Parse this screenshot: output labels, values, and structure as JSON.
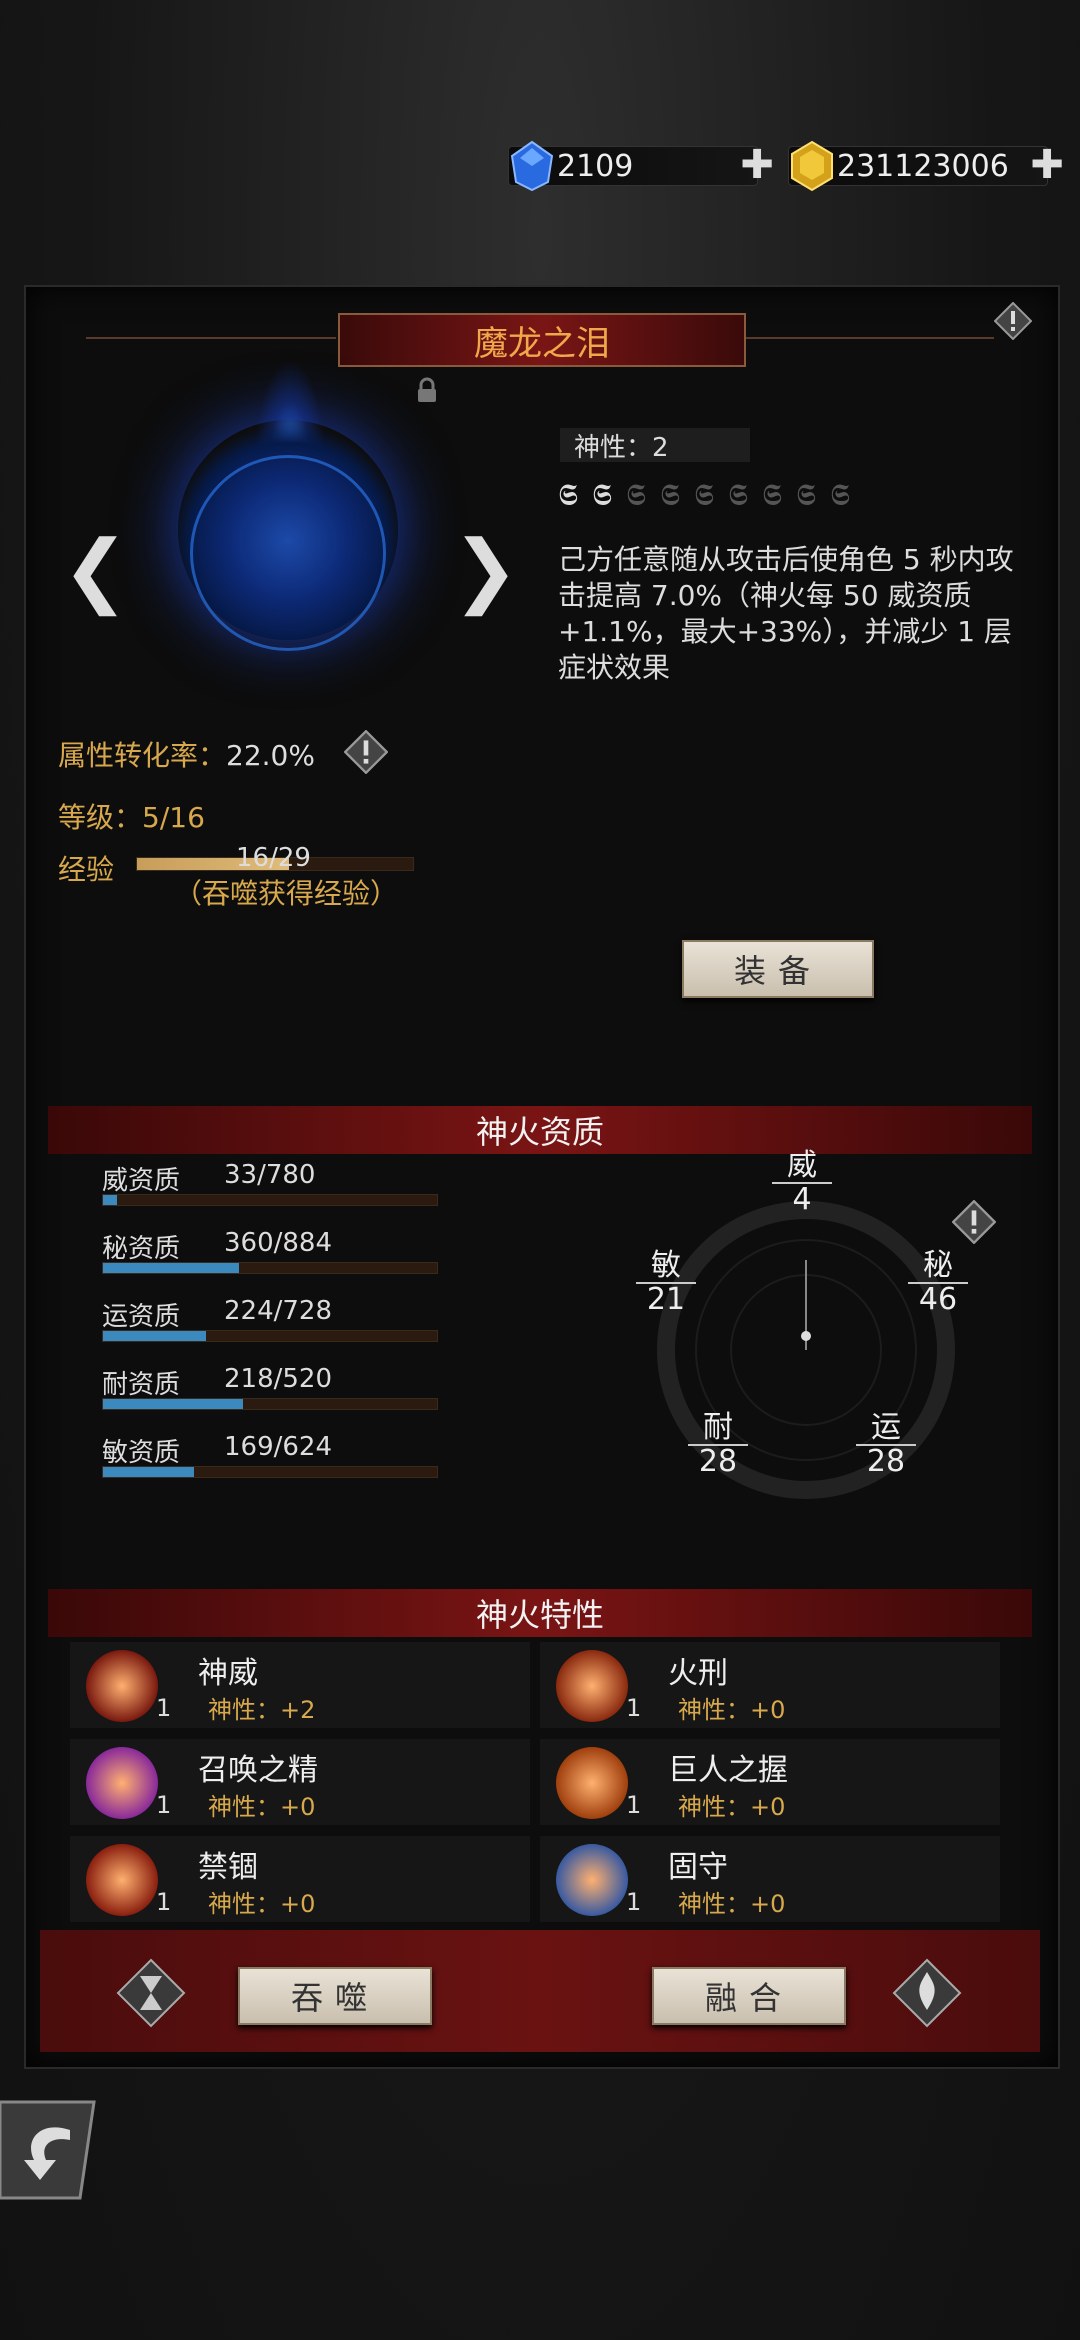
{
  "currency": {
    "gems": "2109",
    "gold": "231123006"
  },
  "item": {
    "title": "魔龙之泪",
    "divinity_label": "神性：2",
    "divinity_level": 2,
    "divinity_max": 9,
    "description": "己方任意随从攻击后使角色 5 秒内攻击提高 7.0%（神火每 50 威资质 +1.1%，最大+33%），并减少 1 层症状效果"
  },
  "stats": {
    "conversion_label": "属性转化率：",
    "conversion_value": "22.0%",
    "level_label": "等级：",
    "level_value": "5/16",
    "exp_label": "经验",
    "exp_value": "16/29",
    "exp_fraction": 0.55,
    "exp_hint": "（吞噬获得经验）"
  },
  "buttons": {
    "equip": "装备",
    "devour": "吞噬",
    "fuse": "融合"
  },
  "qualities": {
    "header": "神火资质",
    "rows": [
      {
        "label": "威资质",
        "value": "33/780",
        "fraction": 0.042
      },
      {
        "label": "秘资质",
        "value": "360/884",
        "fraction": 0.407
      },
      {
        "label": "运资质",
        "value": "224/728",
        "fraction": 0.308
      },
      {
        "label": "耐资质",
        "value": "218/520",
        "fraction": 0.419
      },
      {
        "label": "敏资质",
        "value": "169/624",
        "fraction": 0.271
      }
    ],
    "radar": [
      {
        "label": "威",
        "value": "4"
      },
      {
        "label": "秘",
        "value": "46"
      },
      {
        "label": "运",
        "value": "28"
      },
      {
        "label": "耐",
        "value": "28"
      },
      {
        "label": "敏",
        "value": "21"
      }
    ]
  },
  "traits": {
    "header": "神火特性",
    "items": [
      {
        "name": "神威",
        "level": "1",
        "divinity": "神性：+2",
        "icon": "wave-icon",
        "color": "#7a1a10"
      },
      {
        "name": "火刑",
        "level": "1",
        "divinity": "神性：+0",
        "icon": "flame-icon",
        "color": "#8a2a10"
      },
      {
        "name": "召唤之精",
        "level": "1",
        "divinity": "神性：+0",
        "icon": "skull-icon",
        "color": "#8a2a9a"
      },
      {
        "name": "巨人之握",
        "level": "1",
        "divinity": "神性：+0",
        "icon": "fist-icon",
        "color": "#a0400e"
      },
      {
        "name": "禁锢",
        "level": "1",
        "divinity": "神性：+0",
        "icon": "spiral-icon",
        "color": "#8a2010"
      },
      {
        "name": "固守",
        "level": "1",
        "divinity": "神性：+0",
        "icon": "shield-icon",
        "color": "#3a5aa0"
      }
    ]
  }
}
